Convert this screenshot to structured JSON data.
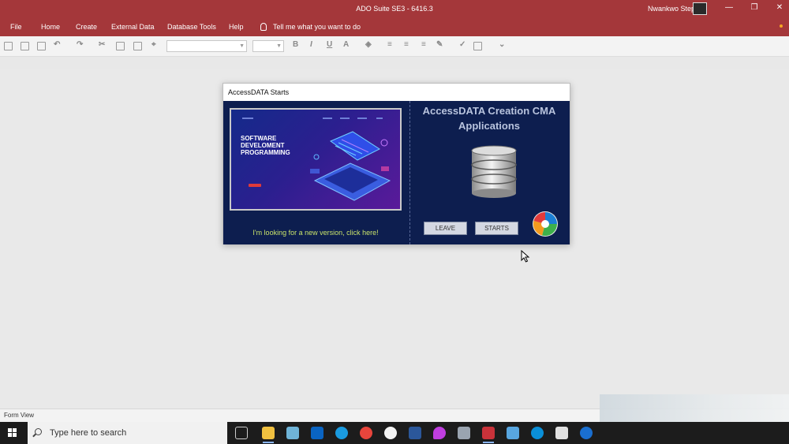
{
  "window": {
    "title": "ADO Suite SE3 - 6416.3",
    "user_name": "Nwankwo Stephen",
    "minimize": "—",
    "restore": "❐",
    "close": "✕"
  },
  "ribbon": {
    "tabs": [
      "File",
      "Home",
      "Create",
      "External Data",
      "Database Tools",
      "Help"
    ],
    "tell_me": "Tell me what you want to do"
  },
  "toolbar": {
    "bold": "B",
    "italic": "I",
    "underline": "U",
    "font_color": "A",
    "more": "⌄"
  },
  "form": {
    "title": "AccessDATA Starts",
    "heading": "AccessDATA Creation CMA Applications",
    "promo_lines": [
      "SOFTWARE",
      "DEVELOMENT",
      "PROGRAMMING"
    ],
    "link_text": "I'm looking for a new version, click here!",
    "leave_button": "LEAVE",
    "starts_button": "STARTS"
  },
  "status": {
    "view": "Form View"
  },
  "taskbar": {
    "search_placeholder": "Type here to search"
  },
  "colors": {
    "title_bar": "#a4373a",
    "form_background": "#0d1e4f",
    "link": "#c8e26a",
    "taskbar": "#1c1c1c"
  }
}
